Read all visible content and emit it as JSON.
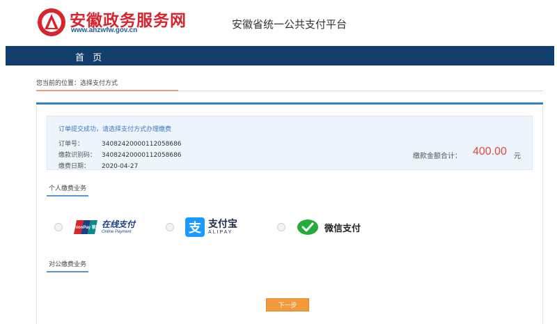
{
  "header": {
    "brand_title": "安徽政务服务网",
    "brand_url": "www.ahzwfw.gov.cn",
    "platform_title": "安徽省统一公共支付平台"
  },
  "nav": {
    "home_label": "首 页"
  },
  "breadcrumb": {
    "text": "您当前的位置：选择支付方式"
  },
  "order": {
    "message": "订单提交成功，请选择支付方式办理缴费",
    "fields": [
      {
        "label": "订单号：",
        "value": "34082420000112058686"
      },
      {
        "label": "缴款识别码：",
        "value": "34082420000112058686"
      },
      {
        "label": "缴费日期：",
        "value": "2020-04-27"
      }
    ],
    "total_label": "缴款金额合计：",
    "total_amount": "400.00",
    "total_unit": "元"
  },
  "sections": {
    "personal": "个人缴费业务",
    "corporate": "对公缴费业务"
  },
  "payment_methods": [
    {
      "id": "unionpay",
      "label": "在线支付",
      "sub": "Online Payment",
      "logo_text": "UnionPay 银联",
      "icon": "unionpay-icon"
    },
    {
      "id": "alipay",
      "label": "支付宝",
      "sub": "ALIPAY",
      "logo_text": "支",
      "icon": "alipay-icon"
    },
    {
      "id": "wechat",
      "label": "微信支付",
      "icon": "wechat-pay-icon"
    }
  ],
  "actions": {
    "next_label": "下一步"
  },
  "colors": {
    "brand_red": "#d9232d",
    "nav_blue": "#123e6c",
    "accent_blue": "#2f80d1",
    "amount_red": "#e2483f",
    "button_orange": "#f29a3b"
  }
}
